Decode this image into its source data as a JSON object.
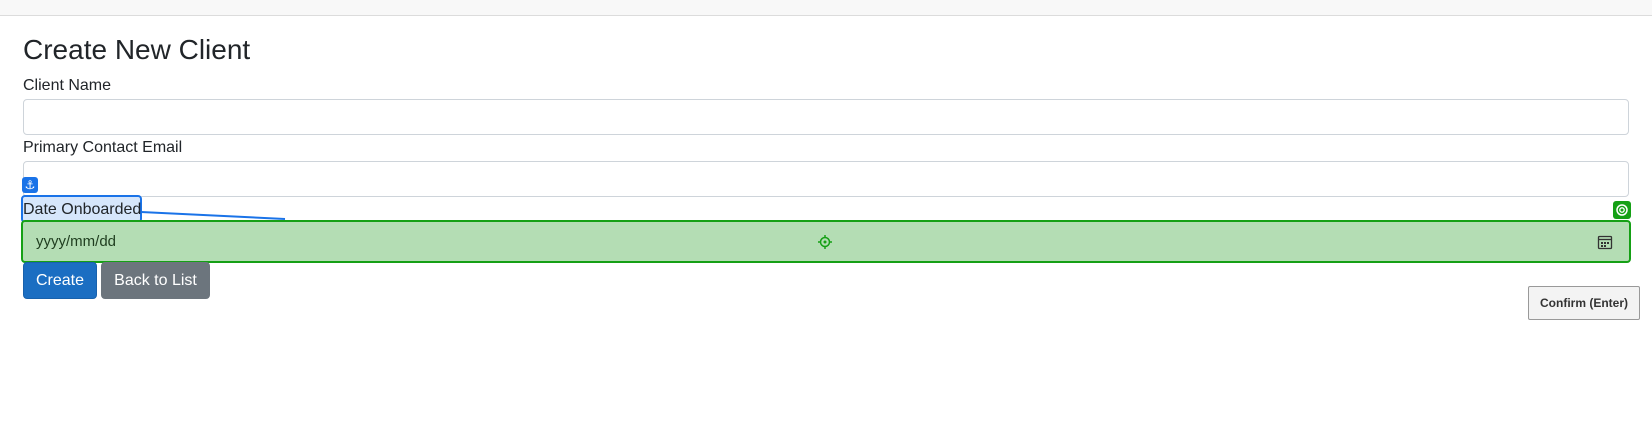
{
  "page": {
    "title": "Create New Client"
  },
  "form": {
    "client_name": {
      "label": "Client Name",
      "value": ""
    },
    "primary_contact_email": {
      "label": "Primary Contact Email",
      "value": ""
    },
    "date_onboarded": {
      "label": "Date Onboarded",
      "placeholder": "yyyy/mm/dd"
    }
  },
  "actions": {
    "create_label": "Create",
    "back_label": "Back to List"
  },
  "overlay": {
    "confirm_label": "Confirm (Enter)",
    "anchor_icon": "anchor-icon",
    "target_icon": "crosshair-icon",
    "accent_blue": "#1a73e8",
    "accent_green": "#15a015"
  }
}
